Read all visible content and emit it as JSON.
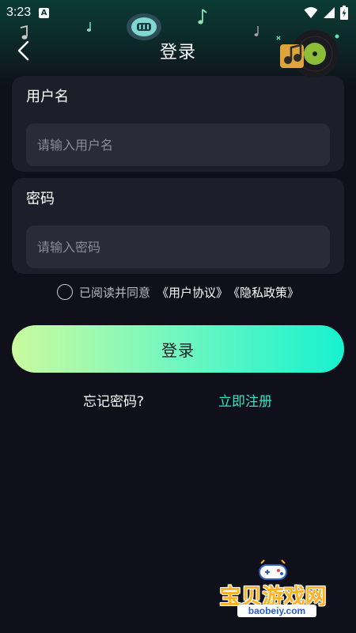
{
  "status_bar": {
    "time": "3:23",
    "app_icon_letter": "A"
  },
  "nav": {
    "title": "登录"
  },
  "username_card": {
    "label": "用户名",
    "placeholder": "请输入用户名",
    "value": ""
  },
  "password_card": {
    "label": "密码",
    "placeholder": "请输入密码",
    "value": ""
  },
  "agreement": {
    "checked": false,
    "prefix": "已阅读并同意",
    "user_agreement": "《用户协议》",
    "privacy_policy": "《隐私政策》"
  },
  "login_button_label": "登录",
  "links": {
    "forgot_password": "忘记密码?",
    "register": "立即注册"
  },
  "watermark": {
    "title": "宝贝游戏网",
    "subtitle": "baobeiy.com"
  },
  "colors": {
    "background": "#0f101a",
    "card": "#1d1e2a",
    "input": "#2a2b38",
    "accent": "#2ee6c2",
    "button_gradient_start": "#c9fb9e",
    "button_gradient_end": "#17f1cf"
  }
}
